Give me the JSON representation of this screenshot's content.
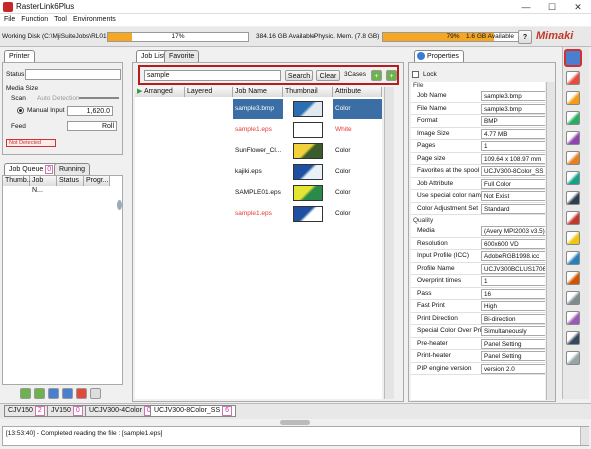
{
  "window": {
    "title": "RasterLink6Plus",
    "minimize": "—",
    "maximize": "☐",
    "close": "✕"
  },
  "menu": [
    "File",
    "Function",
    "Tool",
    "Environments"
  ],
  "status": {
    "working_disk_label": "Working Disk (C:\\MjiSuiteJobs\\RL01.)",
    "working_disk_pct": 17,
    "working_disk_pct_text": "17%",
    "working_disk_avail": "384.16 GB Available",
    "phys_mem_label": "Physic. Mem. (7.8 GB)",
    "phys_mem_pct": 79,
    "phys_mem_pct_text": "79%",
    "phys_mem_avail": "1.6 GB Available",
    "help": "?",
    "brand": "Mimaki"
  },
  "printer": {
    "tab": "Printer",
    "status_label": "Status",
    "media_size_label": "Media Size",
    "scan_label": "Scan",
    "auto_detection": "Auto Detection",
    "manual_input": "Manual Input",
    "manual_value": "1,620.0",
    "feed_label": "Feed",
    "feed_value": "Roll",
    "not_detected": "Not Detected"
  },
  "job_queue": {
    "tabs": [
      {
        "label": "Job Queue",
        "count": "0"
      },
      {
        "label": "Running"
      }
    ],
    "columns": [
      "Thumb...",
      "Job N...",
      "Status",
      "Progr..."
    ]
  },
  "job_list": {
    "tabs": [
      "Job List",
      "Favorite"
    ],
    "search_value": "sample",
    "search_btn": "Search",
    "clear_btn": "Clear",
    "cases": "3Cases",
    "plus": "+",
    "columns": [
      "Arranged",
      "Layered",
      "Job Name",
      "Thumbnail",
      "Attribute"
    ],
    "rows": [
      {
        "name": "sample3.bmp",
        "attr": "Color",
        "selected": true,
        "red": false
      },
      {
        "name": "sample1.eps",
        "attr": "White",
        "selected": false,
        "red": true
      },
      {
        "name": "SunFlower_Cl...",
        "attr": "Color",
        "selected": false,
        "red": false
      },
      {
        "name": "kajiki.eps",
        "attr": "Color",
        "selected": false,
        "red": false
      },
      {
        "name": "SAMPLE01.eps",
        "attr": "Color",
        "selected": false,
        "red": false
      },
      {
        "name": "sample1.eps",
        "attr": "Color",
        "selected": false,
        "red": true
      }
    ]
  },
  "properties": {
    "tab": "Properties",
    "lock": "Lock",
    "file_section": "File",
    "quality_section": "Quality",
    "file_rows": [
      {
        "k": "Job Name",
        "v": "sample3.bmp"
      },
      {
        "k": "File Name",
        "v": "sample3.bmp"
      },
      {
        "k": "Format",
        "v": "BMP"
      },
      {
        "k": "Image Size",
        "v": "4.77 MB"
      },
      {
        "k": "Pages",
        "v": "1"
      },
      {
        "k": "Page size",
        "v": "109.64 x 108.97 mm"
      },
      {
        "k": "Favorites at the spool",
        "v": "UCJV300-8Color_SS"
      },
      {
        "k": "Job Attribute",
        "v": "Full Color"
      },
      {
        "k": "Use special color names",
        "v": "Not Exist"
      },
      {
        "k": "Color Adjustment Set",
        "v": "Standard"
      }
    ],
    "quality_rows": [
      {
        "k": "Media",
        "v": "(Avery MPI2003 v3.5)"
      },
      {
        "k": "Resolution",
        "v": "600x600 VD"
      },
      {
        "k": "Input Profile (ICC)",
        "v": "AdobeRGB1998.icc"
      },
      {
        "k": "Profile Name",
        "v": "UCJV300BCLUS1706C_..."
      },
      {
        "k": "Overprint times",
        "v": "1"
      },
      {
        "k": "Pass",
        "v": "16"
      },
      {
        "k": "Fast Print",
        "v": "High"
      },
      {
        "k": "Print Direction",
        "v": "Bi-direction"
      },
      {
        "k": "Special Color Over Print",
        "v": "Simultaneously"
      },
      {
        "k": "Pre-heater",
        "v": "Panel Setting"
      },
      {
        "k": "Print-heater",
        "v": "Panel Setting"
      },
      {
        "k": "PIP engine version",
        "v": "version 2.0"
      }
    ]
  },
  "printers_tabs": [
    {
      "label": "CJV150",
      "n": "2"
    },
    {
      "label": "JV150",
      "n": "0"
    },
    {
      "label": "UCJV300-4Color",
      "n": "0"
    },
    {
      "label": "UCJV300-8Color_SS",
      "n": "6"
    }
  ],
  "log": "[13:53:40] - Completed reading the file : [sample1.eps]",
  "colors": {
    "accent": "#c0392b",
    "orange": "#f5a623",
    "selected_row": "#3a6ea5",
    "side_border": "#d32f2f"
  }
}
